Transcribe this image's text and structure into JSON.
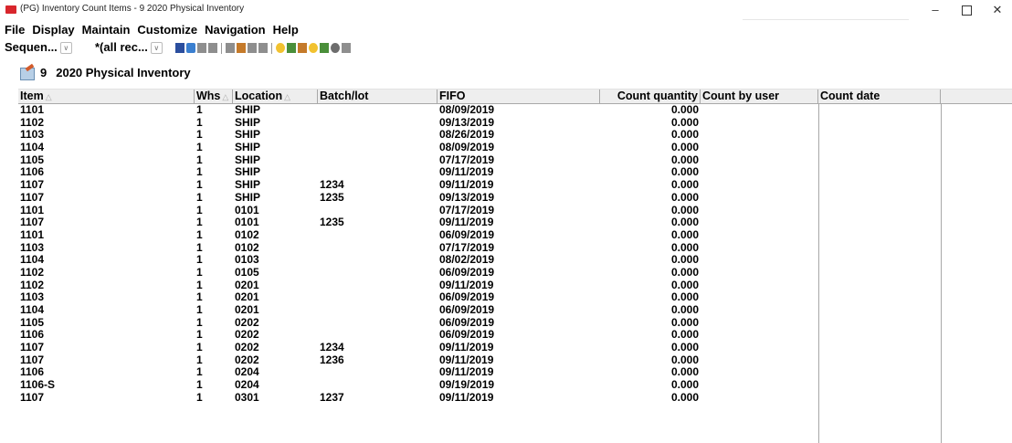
{
  "window": {
    "title": "(PG) Inventory Count Items - 9  2020 Physical Inventory",
    "minimize_glyph": "–",
    "close_glyph": "✕"
  },
  "menu": [
    "File",
    "Display",
    "Maintain",
    "Customize",
    "Navigation",
    "Help"
  ],
  "toolbar": {
    "sequence_value": "Sequen...",
    "filter_value": "*(all rec...",
    "icons": [
      "binoculars-icon",
      "window-icon",
      "filter-icon",
      "print-icon",
      "new-icon",
      "edit-icon",
      "split-icon",
      "tree-icon",
      "person-icon",
      "people-icon",
      "group-icon",
      "tool-icon",
      "grid-icon",
      "link-icon",
      "pencil-icon"
    ]
  },
  "heading": {
    "number": "9",
    "title": "2020 Physical Inventory"
  },
  "table": {
    "columns": [
      "Item",
      "Whs",
      "Location",
      "Batch/lot",
      "FIFO",
      "Count quantity",
      "Count by user",
      "Count date"
    ],
    "rows": [
      [
        "1101",
        "1",
        "SHIP",
        "",
        "08/09/2019",
        "0.000",
        "",
        ""
      ],
      [
        "1102",
        "1",
        "SHIP",
        "",
        "09/13/2019",
        "0.000",
        "",
        ""
      ],
      [
        "1103",
        "1",
        "SHIP",
        "",
        "08/26/2019",
        "0.000",
        "",
        ""
      ],
      [
        "1104",
        "1",
        "SHIP",
        "",
        "08/09/2019",
        "0.000",
        "",
        ""
      ],
      [
        "1105",
        "1",
        "SHIP",
        "",
        "07/17/2019",
        "0.000",
        "",
        ""
      ],
      [
        "1106",
        "1",
        "SHIP",
        "",
        "09/11/2019",
        "0.000",
        "",
        ""
      ],
      [
        "1107",
        "1",
        "SHIP",
        "1234",
        "09/11/2019",
        "0.000",
        "",
        ""
      ],
      [
        "1107",
        "1",
        "SHIP",
        "1235",
        "09/13/2019",
        "0.000",
        "",
        ""
      ],
      [
        "1101",
        "1",
        "0101",
        "",
        "07/17/2019",
        "0.000",
        "",
        ""
      ],
      [
        "1107",
        "1",
        "0101",
        "1235",
        "09/11/2019",
        "0.000",
        "",
        ""
      ],
      [
        "1101",
        "1",
        "0102",
        "",
        "06/09/2019",
        "0.000",
        "",
        ""
      ],
      [
        "1103",
        "1",
        "0102",
        "",
        "07/17/2019",
        "0.000",
        "",
        ""
      ],
      [
        "1104",
        "1",
        "0103",
        "",
        "08/02/2019",
        "0.000",
        "",
        ""
      ],
      [
        "1102",
        "1",
        "0105",
        "",
        "06/09/2019",
        "0.000",
        "",
        ""
      ],
      [
        "1102",
        "1",
        "0201",
        "",
        "09/11/2019",
        "0.000",
        "",
        ""
      ],
      [
        "1103",
        "1",
        "0201",
        "",
        "06/09/2019",
        "0.000",
        "",
        ""
      ],
      [
        "1104",
        "1",
        "0201",
        "",
        "06/09/2019",
        "0.000",
        "",
        ""
      ],
      [
        "1105",
        "1",
        "0202",
        "",
        "06/09/2019",
        "0.000",
        "",
        ""
      ],
      [
        "1106",
        "1",
        "0202",
        "",
        "06/09/2019",
        "0.000",
        "",
        ""
      ],
      [
        "1107",
        "1",
        "0202",
        "1234",
        "09/11/2019",
        "0.000",
        "",
        ""
      ],
      [
        "1107",
        "1",
        "0202",
        "1236",
        "09/11/2019",
        "0.000",
        "",
        ""
      ],
      [
        "1106",
        "1",
        "0204",
        "",
        "09/11/2019",
        "0.000",
        "",
        ""
      ],
      [
        "1106-S",
        "1",
        "0204",
        "",
        "09/19/2019",
        "0.000",
        "",
        ""
      ],
      [
        "1107",
        "1",
        "0301",
        "1237",
        "09/11/2019",
        "0.000",
        "",
        ""
      ]
    ]
  }
}
